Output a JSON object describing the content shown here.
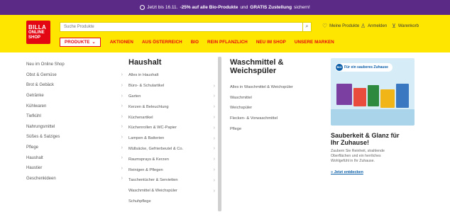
{
  "promo_bar": {
    "text_pre": "Jetzt bis 16.11.",
    "text_bold1": "-25% auf alle Bio-Produkte",
    "text_mid": "und",
    "text_bold2": "GRATIS Zustellung",
    "text_post": "sichern!"
  },
  "header": {
    "logo": {
      "line1": "BILLA",
      "line2": "ONLINE",
      "line3": "SHOP"
    },
    "search_placeholder": "Suche Produkte",
    "utils": [
      {
        "icon": "heart-icon",
        "glyph": "♡",
        "label": "Meine Produkte"
      },
      {
        "icon": "user-icon",
        "glyph": "♙",
        "label": "Anmelden"
      },
      {
        "icon": "cart-icon",
        "glyph": "⊻",
        "label": "Warenkorb"
      }
    ]
  },
  "nav": {
    "products_label": "PRODUKTE",
    "items": [
      "AKTIONEN",
      "AUS ÖSTERREICH",
      "BIO",
      "REIN PFLANZLICH",
      "NEU IM SHOP",
      "UNSERE MARKEN"
    ]
  },
  "categories": [
    "Neu im Online Shop",
    "Obst & Gemüse",
    "Brot & Gebäck",
    "Getränke",
    "Kühlwaren",
    "Tiefkühl",
    "Nahrungsmittel",
    "Süßes & Salziges",
    "Pflege",
    "Haushalt",
    "Haustier",
    "Geschenkideen"
  ],
  "subcategories": {
    "title": "Haushalt",
    "items": [
      "Alles in Haushalt",
      "Büro- & Schulartikel",
      "Garten",
      "Kerzen & Beleuchtung",
      "Küchenartikel",
      "Küchenrollen & WC-Papier",
      "Lampen & Batterien",
      "Müllsäcke, Gefrierbeutel & Co.",
      "Raumsprays & Kerzen",
      "Reinigen & Pflegen",
      "Taschentücher & Servietten",
      "Waschmittel & Weichspüler",
      "Schuhpflege"
    ]
  },
  "subsub": {
    "title_line1": "Waschmittel &",
    "title_line2": "Weichspüler",
    "items": [
      "Alles in Waschmittel & Weichspüler",
      "Waschmittel",
      "Weichspüler",
      "Flecken- & Vorwaschmittel",
      "Pflege"
    ]
  },
  "promo_card": {
    "badge": "Für ein sauberes Zuhause",
    "badge_logo": "BIO",
    "headline_line1": "Sauberkeit & Glanz für",
    "headline_line2": "Ihr Zuhause!",
    "body_line1": "Zaubern Sie Reinheit, strahlende",
    "body_line2": "Oberflächen und ein herrliches",
    "body_line3": "Wohlgefühl in Ihr Zuhause.",
    "link": "» Jetzt entdecken"
  },
  "colors": {
    "promo_bg": "#5b2a86",
    "header_bg": "#ffe600",
    "brand_red": "#e30613",
    "link_blue": "#0a5ea8"
  }
}
